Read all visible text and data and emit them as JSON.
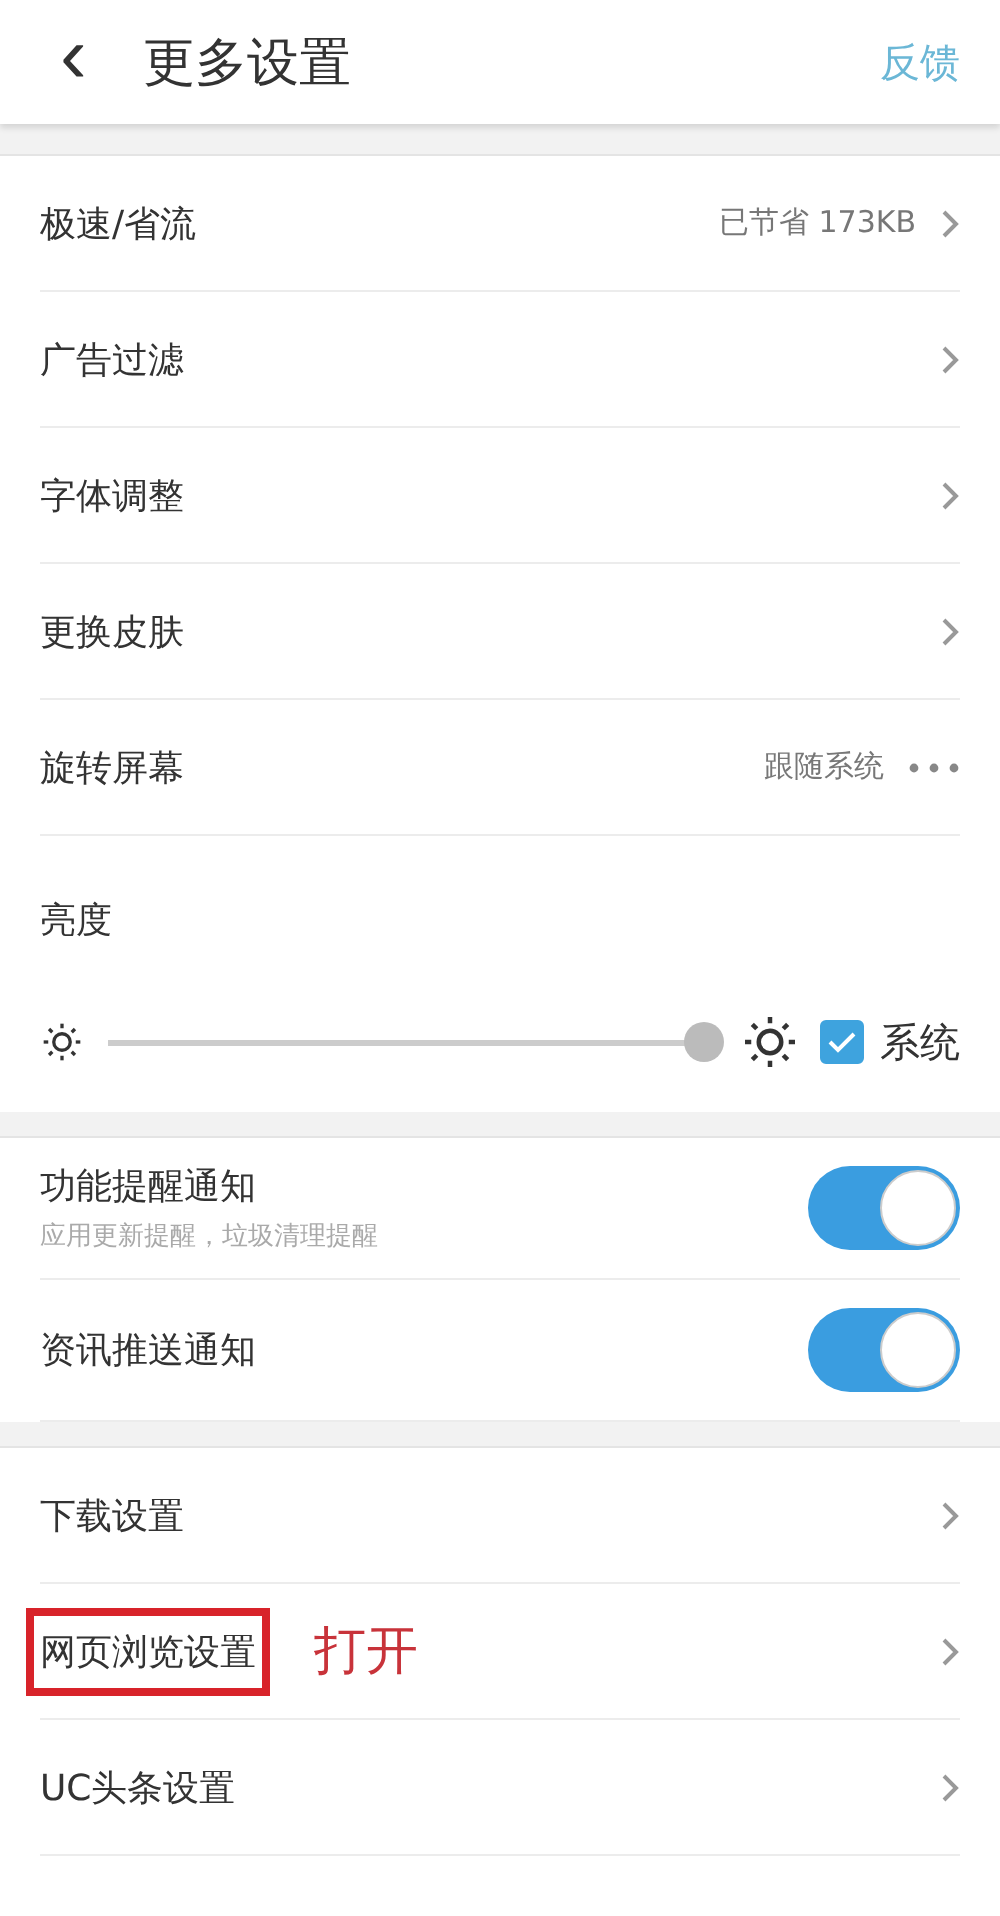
{
  "header": {
    "back": "‹",
    "title": "更多设置",
    "action": "反馈"
  },
  "section_1": [
    {
      "kind": "link",
      "label": "极速/省流",
      "value": "已节省 173KB"
    },
    {
      "kind": "link",
      "label": "广告过滤"
    },
    {
      "kind": "link",
      "label": "字体调整"
    },
    {
      "kind": "link",
      "label": "更换皮肤"
    },
    {
      "kind": "option",
      "label": "旋转屏幕",
      "value": "跟随系统"
    }
  ],
  "brightness": {
    "label": "亮度",
    "level": 0.98,
    "system": {
      "label": "系统",
      "checked": true
    }
  },
  "notifications": [
    {
      "label": "功能提醒通知",
      "sublabel": "应用更新提醒，垃圾清理提醒",
      "on": true
    },
    {
      "label": "资讯推送通知",
      "on": true
    }
  ],
  "section_2": [
    {
      "kind": "link",
      "label": "下载设置"
    },
    {
      "kind": "link",
      "label": "网页浏览设置",
      "highlighted": true,
      "annotation": "打开"
    },
    {
      "kind": "link",
      "label": "UC头条设置"
    }
  ]
}
